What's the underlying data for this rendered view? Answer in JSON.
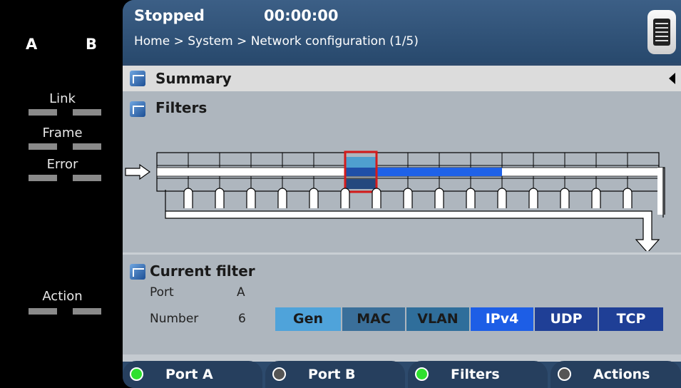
{
  "left_panel": {
    "port_a": "A",
    "port_b": "B",
    "indicators": [
      "Link",
      "Frame",
      "Error",
      "Action"
    ]
  },
  "header": {
    "state": "Stopped",
    "elapsed": "00:00:00",
    "breadcrumb": "Home > System > Network configuration (1/5)",
    "menu_icon": "menu-icon"
  },
  "sections": {
    "summary": "Summary",
    "filters": "Filters",
    "current_filter": "Current filter"
  },
  "current_filter": {
    "port_label": "Port",
    "port_value": "A",
    "number_label": "Number",
    "number_value": "6",
    "protocols": [
      {
        "name": "Gen",
        "bg": "#4fa3da",
        "fg": "#1a1a1a"
      },
      {
        "name": "MAC",
        "bg": "#3a6f9a",
        "fg": "#1a1a1a"
      },
      {
        "name": "VLAN",
        "bg": "#2f6e9b",
        "fg": "#1a1a1a"
      },
      {
        "name": "IPv4",
        "bg": "#1d5ee6",
        "fg": "#ffffff"
      },
      {
        "name": "UDP",
        "bg": "#1f3f96",
        "fg": "#ffffff"
      },
      {
        "name": "TCP",
        "bg": "#1f3f96",
        "fg": "#ffffff"
      }
    ]
  },
  "filter_pipeline": {
    "cell_count": 16,
    "selected_index": 6,
    "active_indices": [
      6,
      7,
      8,
      9,
      10
    ]
  },
  "buttons": [
    {
      "label": "Port A",
      "led": "#2ee02e"
    },
    {
      "label": "Port B",
      "led": "#555555"
    },
    {
      "label": "Filters",
      "led": "#2ee02e"
    },
    {
      "label": "Actions",
      "led": "#555555"
    }
  ],
  "colors": {
    "selected_outline": "#d41b1b",
    "active_bar": "#1f62e8",
    "frame": "#2d4a6c"
  }
}
